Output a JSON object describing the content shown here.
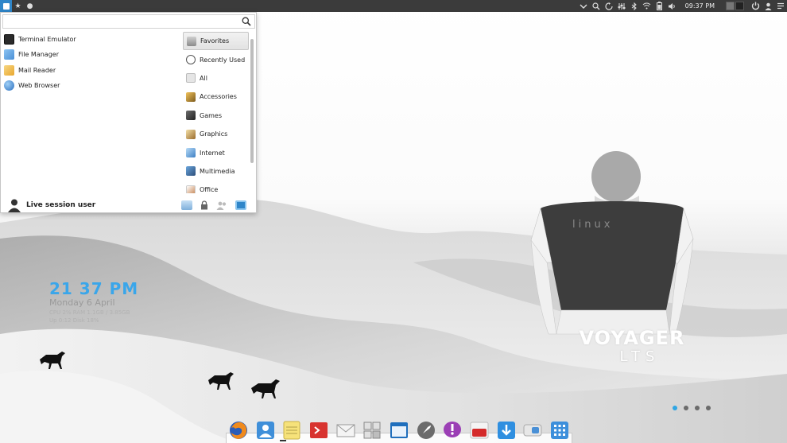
{
  "search": {
    "value": "",
    "placeholder": ""
  },
  "apps": [
    {
      "label": "Terminal Emulator",
      "icon": "terminal-icon",
      "color": "#2b2b2b"
    },
    {
      "label": "File Manager",
      "icon": "file-manager-icon",
      "color": "#4a8fd6"
    },
    {
      "label": "Mail Reader",
      "icon": "mail-icon",
      "color": "#e8a62e"
    },
    {
      "label": "Web Browser",
      "icon": "web-browser-icon",
      "color": "#2b6fbf"
    }
  ],
  "categories": [
    {
      "label": "Favorites",
      "icon": "favorites-icon",
      "selected": true
    },
    {
      "label": "Recently Used",
      "icon": "recently-used-icon",
      "selected": false
    },
    {
      "label": "All",
      "icon": "all-icon",
      "selected": false
    },
    {
      "label": "Accessories",
      "icon": "accessories-icon",
      "selected": false
    },
    {
      "label": "Games",
      "icon": "games-icon",
      "selected": false
    },
    {
      "label": "Graphics",
      "icon": "graphics-icon",
      "selected": false
    },
    {
      "label": "Internet",
      "icon": "internet-icon",
      "selected": false
    },
    {
      "label": "Multimedia",
      "icon": "multimedia-icon",
      "selected": false
    },
    {
      "label": "Office",
      "icon": "office-icon",
      "selected": false
    }
  ],
  "user": {
    "name": "Live session user"
  },
  "panel": {
    "clock": "09:37 PM"
  },
  "conky": {
    "time": "21 37 PM",
    "date": "Monday  6 April",
    "stats_line1": "CPU 2%  RAM 1.1GB / 3.85GB",
    "stats_line2": "Up 0:12  Disk 18%"
  },
  "logo": {
    "title": "VOYAGER",
    "subtitle": "LTS"
  },
  "shirt_text": "linux",
  "colors": {
    "accent": "#2f86c9",
    "panel": "#3b3b3b",
    "conky_time": "#3aa6ea"
  },
  "dock": [
    "firefox-icon",
    "contacts-icon",
    "notes-icon",
    "terminal-icon",
    "mail-icon",
    "workspace-switcher-icon",
    "window-icon",
    "rocket-icon",
    "chat-icon",
    "youtube-icon",
    "download-icon",
    "toggle-icon",
    "app-grid-icon"
  ]
}
